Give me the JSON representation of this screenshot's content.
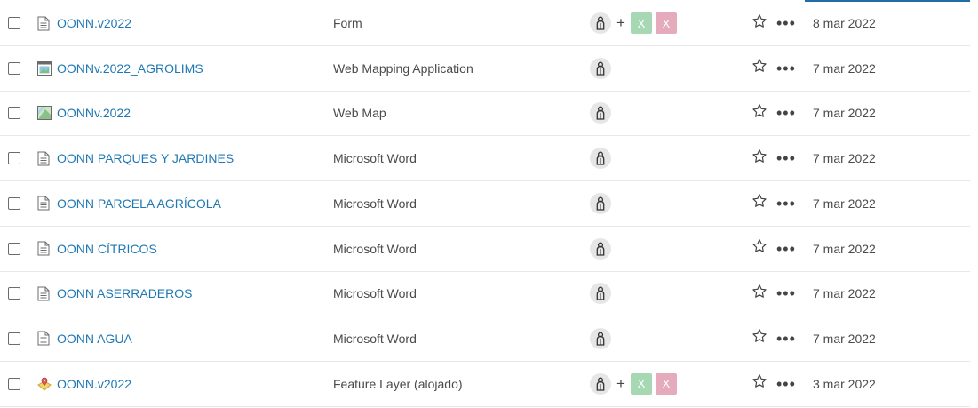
{
  "colors": {
    "link": "#1f78b4",
    "accent": "#1f6fa6",
    "tag_green": "#a6d8b3",
    "tag_pink": "#e4abbd"
  },
  "rows": [
    {
      "icon": "document-icon",
      "title": "OONN.v2022",
      "type": "Form",
      "shared": true,
      "tag_a": "X",
      "tag_b": "X",
      "date": "8 mar 2022"
    },
    {
      "icon": "web-mapping-app-icon",
      "title": "OONNv.2022_AGROLIMS",
      "type": "Web Mapping Application",
      "shared": false,
      "date": "7 mar 2022"
    },
    {
      "icon": "web-map-icon",
      "title": "OONNv.2022",
      "type": "Web Map",
      "shared": false,
      "date": "7 mar 2022"
    },
    {
      "icon": "document-icon",
      "title": "OONN PARQUES Y JARDINES",
      "type": "Microsoft Word",
      "shared": false,
      "date": "7 mar 2022"
    },
    {
      "icon": "document-icon",
      "title": "OONN PARCELA AGRÍCOLA",
      "type": "Microsoft Word",
      "shared": false,
      "date": "7 mar 2022"
    },
    {
      "icon": "document-icon",
      "title": "OONN CÍTRICOS",
      "type": "Microsoft Word",
      "shared": false,
      "date": "7 mar 2022"
    },
    {
      "icon": "document-icon",
      "title": "OONN ASERRADEROS",
      "type": "Microsoft Word",
      "shared": false,
      "date": "7 mar 2022"
    },
    {
      "icon": "document-icon",
      "title": "OONN AGUA",
      "type": "Microsoft Word",
      "shared": false,
      "date": "7 mar 2022"
    },
    {
      "icon": "feature-layer-icon",
      "title": "OONN.v2022",
      "type": "Feature Layer (alojado)",
      "shared": true,
      "tag_a": "X",
      "tag_b": "X",
      "date": "3 mar 2022"
    }
  ]
}
